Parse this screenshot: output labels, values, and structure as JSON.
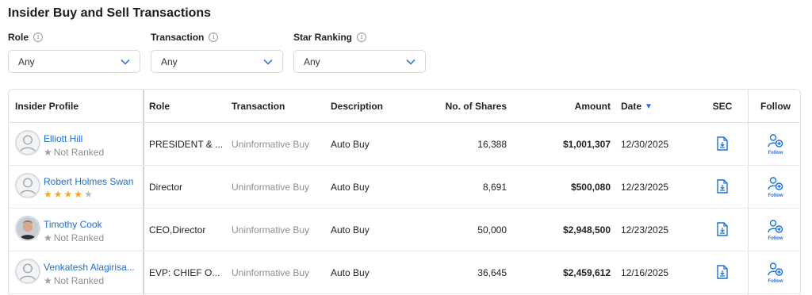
{
  "page": {
    "title": "Insider Buy and Sell Transactions"
  },
  "filters": [
    {
      "label": "Role",
      "value": "Any"
    },
    {
      "label": "Transaction",
      "value": "Any"
    },
    {
      "label": "Star Ranking",
      "value": "Any"
    }
  ],
  "table": {
    "headers": {
      "profile": "Insider Profile",
      "role": "Role",
      "transaction": "Transaction",
      "description": "Description",
      "shares": "No. of Shares",
      "amount": "Amount",
      "date": "Date",
      "sec": "SEC",
      "follow": "Follow"
    },
    "follow_label": "Follow",
    "rows": [
      {
        "name": "Elliott Hill",
        "rank_text": "Not Ranked",
        "stars": 0,
        "role": "PRESIDENT & ...",
        "transaction": "Uninformative Buy",
        "description": "Auto Buy",
        "shares": "16,388",
        "amount": "$1,001,307",
        "date": "12/30/2025",
        "avatar": "placeholder"
      },
      {
        "name": "Robert Holmes Swan",
        "rank_text": "",
        "stars": 4,
        "role": "Director",
        "transaction": "Uninformative Buy",
        "description": "Auto Buy",
        "shares": "8,691",
        "amount": "$500,080",
        "date": "12/23/2025",
        "avatar": "placeholder"
      },
      {
        "name": "Timothy Cook",
        "rank_text": "Not Ranked",
        "stars": 0,
        "role": "CEO,Director",
        "transaction": "Uninformative Buy",
        "description": "Auto Buy",
        "shares": "50,000",
        "amount": "$2,948,500",
        "date": "12/23/2025",
        "avatar": "photo"
      },
      {
        "name": "Venkatesh Alagirisa...",
        "rank_text": "Not Ranked",
        "stars": 0,
        "role": "EVP: CHIEF O...",
        "transaction": "Uninformative Buy",
        "description": "Auto Buy",
        "shares": "36,645",
        "amount": "$2,459,612",
        "date": "12/16/2025",
        "avatar": "placeholder"
      }
    ]
  },
  "colors": {
    "link": "#1e6fd9",
    "star_gold": "#f5a623",
    "muted": "#8a8f96"
  }
}
